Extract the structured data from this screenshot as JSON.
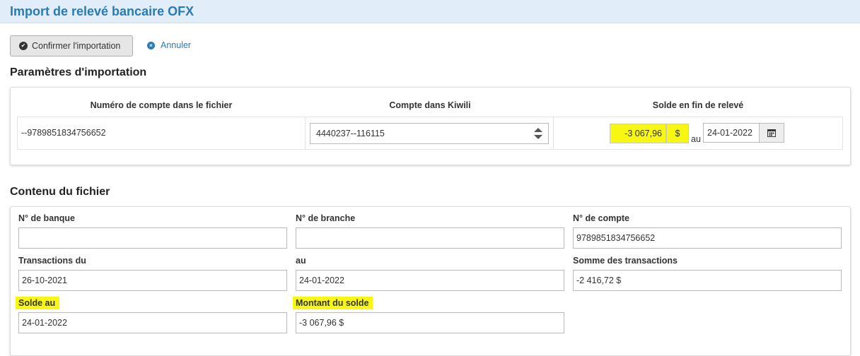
{
  "page": {
    "title": "Import de relevé bancaire OFX"
  },
  "actions": {
    "confirm_label": "Confirmer l'importation",
    "cancel_label": "Annuler"
  },
  "params": {
    "heading": "Paramètres d'importation",
    "col_account_file": "Numéro de compte dans le fichier",
    "col_account_kiwili": "Compte dans Kiwili",
    "col_balance": "Solde en fin de relevé",
    "account_number": "--9789851834756652",
    "kiwili_account": "4440237--116115",
    "balance_value": "-3 067,96",
    "currency": "$",
    "au_label": "au",
    "balance_date": "24-01-2022"
  },
  "content": {
    "heading": "Contenu du fichier",
    "fields": {
      "bank_no": {
        "label": "N° de banque",
        "value": ""
      },
      "branch_no": {
        "label": "N° de branche",
        "value": ""
      },
      "account_no": {
        "label": "N° de compte",
        "value": "9789851834756652"
      },
      "tx_from": {
        "label": "Transactions du",
        "value": "26-10-2021"
      },
      "tx_to": {
        "label": "au",
        "value": "24-01-2022"
      },
      "tx_sum": {
        "label": "Somme des transactions",
        "value": "-2 416,72 $"
      },
      "balance_at": {
        "label": "Solde au",
        "value": "24-01-2022"
      },
      "balance_amount": {
        "label": "Montant du solde",
        "value": "-3 067,96 $"
      }
    }
  },
  "colors": {
    "accent": "#2a7ab8",
    "highlight": "#f7f711",
    "titlebar_bg": "#e1edf8"
  },
  "icons": {
    "confirm": "check-circle-icon",
    "cancel": "times-circle-icon",
    "calendar": "calendar-icon",
    "select": "up-down-arrows-icon"
  }
}
